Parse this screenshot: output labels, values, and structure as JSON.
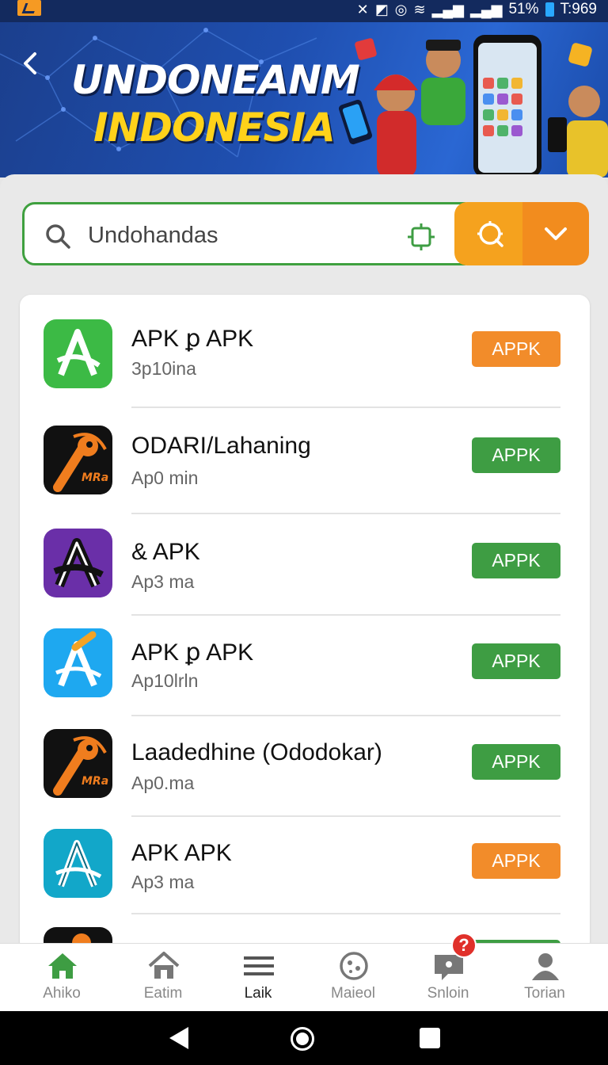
{
  "status_bar": {
    "battery": "51%",
    "clock": "T:969",
    "icons": [
      "notification-icon",
      "mute-icon",
      "nfc-icon",
      "alarm-icon",
      "wifi-icon",
      "signal-icon",
      "signal-icon",
      "battery-icon"
    ]
  },
  "header": {
    "title_line1": "UNDONEANM",
    "title_line2": "INDONESIA",
    "back_icon": "chevron-left-icon"
  },
  "search": {
    "value": "Undohandas",
    "placeholder": "Undohandas",
    "icons": [
      "search-icon",
      "scan-icon",
      "filter-icon",
      "chevron-down-icon"
    ]
  },
  "apps": [
    {
      "name": "APK ꝑ APK",
      "sub": "3p10ina",
      "button": "APPK",
      "button_color": "#f28c2a",
      "icon": "app-icon-green-a"
    },
    {
      "name": "ODARI/Lahaning",
      "sub": "Ap0 min",
      "button": "APPK",
      "button_color": "#3e9d43",
      "icon": "app-icon-black-orange-mra"
    },
    {
      "name": "& APK",
      "sub": "Ap3 ma",
      "button": "APPK",
      "button_color": "#3e9d43",
      "icon": "app-icon-purple-a"
    },
    {
      "name": "APK ꝑ APK",
      "sub": "Ap10lrln",
      "button": "APPK",
      "button_color": "#3e9d43",
      "icon": "app-icon-blue-a"
    },
    {
      "name": "Laadedhine (Ododokar)",
      "sub": "Ap0.ma",
      "button": "APPK",
      "button_color": "#3e9d43",
      "icon": "app-icon-black-orange-mra"
    },
    {
      "name": "APK APK",
      "sub": "Ap3 ma",
      "button": "APPK",
      "button_color": "#f28c2a",
      "icon": "app-icon-teal-a"
    }
  ],
  "bottom_nav": [
    {
      "label": "Ahiko",
      "icon": "home-icon"
    },
    {
      "label": "Eatim",
      "icon": "home-outline-icon"
    },
    {
      "label": "Laik",
      "icon": "menu-icon"
    },
    {
      "label": "Maieol",
      "icon": "discover-icon"
    },
    {
      "label": "Snloin",
      "icon": "chat-icon"
    },
    {
      "label": "Torian",
      "icon": "profile-icon"
    }
  ],
  "notification_badge": "?",
  "colors": {
    "brand_green": "#3e9d43",
    "accent_orange": "#f28c2a",
    "header_blue": "#1f4fb0",
    "title_yellow": "#ffd21a"
  }
}
